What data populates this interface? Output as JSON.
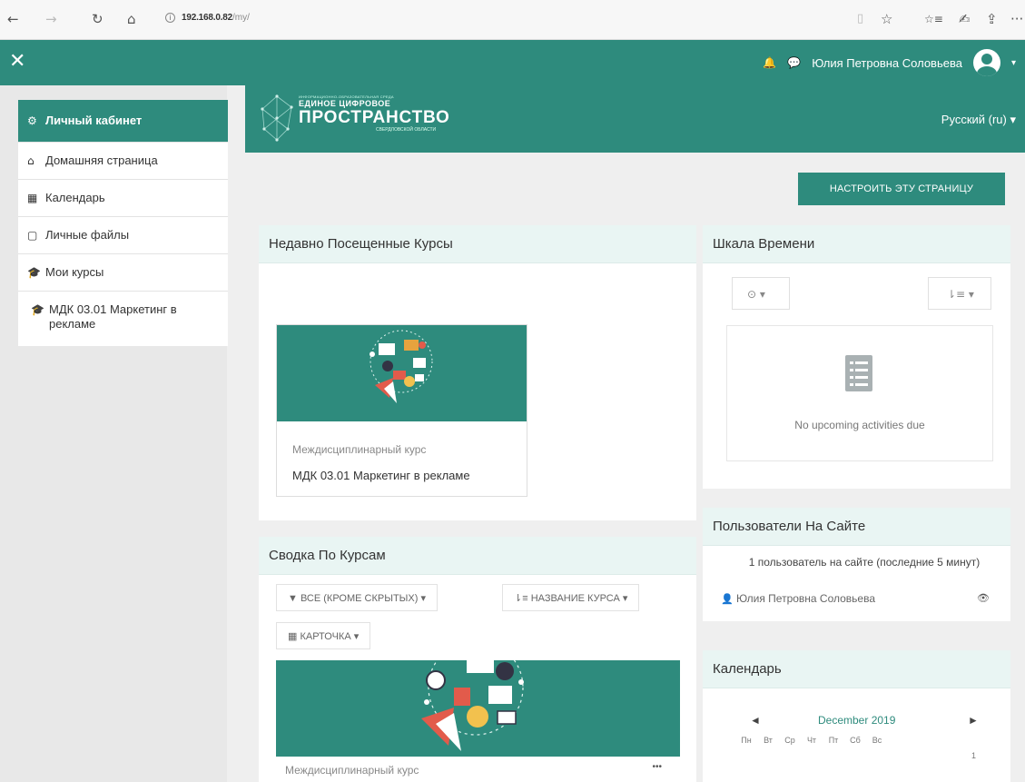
{
  "browser": {
    "back": "←",
    "forward": "→",
    "reload": "↻",
    "home": "⌂",
    "url_host": "192.168.0.82",
    "url_path": "/my/",
    "info_icon": "i",
    "icons": [
      "▯",
      "☆",
      "☆≡",
      "✍",
      "⇪",
      "···"
    ]
  },
  "navbar": {
    "close": "✕",
    "bell": "🔔",
    "chat": "💬",
    "user_name": "Юлия Петровна Соловьева",
    "caret": "▾"
  },
  "sidebar": {
    "items": [
      {
        "icon": "⚙",
        "label": "Личный кабинет"
      },
      {
        "icon": "⌂",
        "label": "Домашняя страница"
      },
      {
        "icon": "▦",
        "label": "Календарь"
      },
      {
        "icon": "▢",
        "label": "Личные файлы"
      },
      {
        "icon": "🎓",
        "label": "Мои курсы"
      },
      {
        "icon": "🎓",
        "label": "МДК 03.01 Маркетинг в рекламе"
      }
    ]
  },
  "banner": {
    "tiny_text": "ИНФОРМАЦИОННО-ОБРАЗОВАТЕЛЬНАЯ СРЕДА",
    "line1": "ЕДИНОЕ ЦИФРОВОЕ",
    "line2": "ПРОСТРАНСТВО",
    "line3": "СВЕРДЛОВСКОЙ ОБЛАСТИ",
    "language": "Русский (ru) ▾"
  },
  "customize_button": "НАСТРОИТЬ ЭТУ СТРАНИЦУ",
  "recent_courses": {
    "title": "Недавно Посещенные Курсы",
    "course_category": "Междисциплинарный курс",
    "course_name": "МДК 03.01 Маркетинг в рекламе"
  },
  "course_overview": {
    "title": "Сводка По Курсам",
    "filter_all": "▼ ВСЕ (КРОМЕ СКРЫТЫХ) ▾",
    "sort_name": "⇂≡ НАЗВАНИЕ КУРСА ▾",
    "view_card": "▦ КАРТОЧКА ▾",
    "course_category": "Междисциплинарный курс",
    "menu_dots": "•••"
  },
  "timeline": {
    "title": "Шкала Времени",
    "filter_btn": "⊙ ▾",
    "sort_btn": "⇂≡ ▾",
    "empty_text": "No upcoming activities due"
  },
  "online_users": {
    "title": "Пользователи На Сайте",
    "summary": "1 пользователь на сайте (последние 5 минут)",
    "user": "Юлия Петровна Соловьева",
    "eye": "👁"
  },
  "calendar": {
    "title": "Календарь",
    "prev": "◄",
    "month": "December 2019",
    "next": "►",
    "weekdays": [
      "Пн",
      "Вт",
      "Ср",
      "Чт",
      "Пт",
      "Сб",
      "Вс"
    ],
    "first_day": "1"
  },
  "colors": {
    "brand": "#2e8b7d",
    "panel_head": "#e9f5f3"
  }
}
